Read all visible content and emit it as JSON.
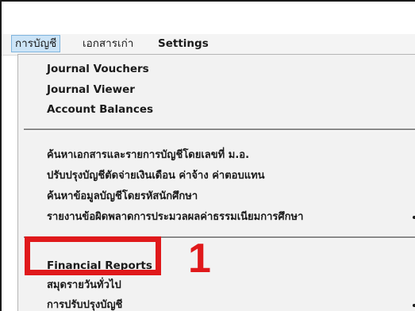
{
  "menu_bar": {
    "items": [
      {
        "label": "การบัญชี",
        "active": true
      },
      {
        "label": "เอกสารเก่า",
        "active": false
      },
      {
        "label": "Settings",
        "active": false
      }
    ]
  },
  "dropdown": {
    "group1": [
      {
        "label": "Journal Vouchers"
      },
      {
        "label": "Journal Viewer"
      },
      {
        "label": "Account Balances"
      }
    ],
    "group2": [
      {
        "label": "ค้นหาเอกสารและรายการบัญชีโดยเลขที่ ม.อ."
      },
      {
        "label": "ปรับปรุงบัญชีตัดจ่ายเงินเดือน ค่าจ้าง ค่าตอบแทน"
      },
      {
        "label": "ค้นหาข้อมูลบัญชีโดยรหัสนักศึกษา"
      },
      {
        "label": "รายงานข้อผิดพลาดการประมวลผลค่าธรรมเนียมการศึกษา"
      }
    ],
    "group3": [
      {
        "label": "Financial Reports"
      },
      {
        "label": "สมุดรายวันทั่วไป"
      },
      {
        "label": "การปรับปรุงบัญชี"
      }
    ]
  },
  "annotation": {
    "callout_number": "1",
    "color": "#e0191b"
  },
  "colors": {
    "menu_active_bg": "#cce4f7",
    "menu_active_border": "#7fb5de",
    "dropdown_bg": "#f2f2f2"
  }
}
